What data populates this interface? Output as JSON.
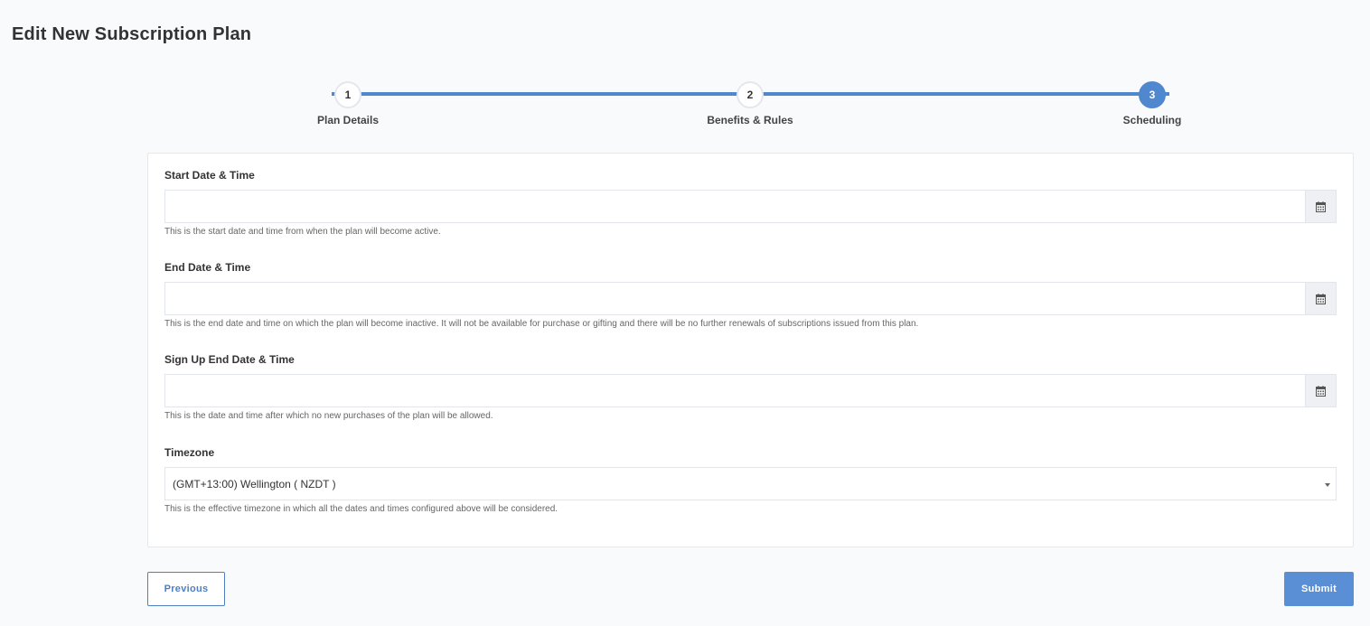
{
  "page": {
    "title": "Edit New Subscription Plan"
  },
  "stepper": {
    "steps": [
      {
        "number": "1",
        "label": "Plan Details"
      },
      {
        "number": "2",
        "label": "Benefits & Rules"
      },
      {
        "number": "3",
        "label": "Scheduling"
      }
    ],
    "active_step": 3
  },
  "form": {
    "start": {
      "label": "Start Date & Time",
      "value": "",
      "help": "This is the start date and time from when the plan will become active."
    },
    "end": {
      "label": "End Date & Time",
      "value": "",
      "help": "This is the end date and time on which the plan will become inactive. It will not be available for purchase or gifting and there will be no further renewals of subscriptions issued from this plan."
    },
    "signup_end": {
      "label": "Sign Up End Date & Time",
      "value": "",
      "help": "This is the date and time after which no new purchases of the plan will be allowed."
    },
    "timezone": {
      "label": "Timezone",
      "selected": "(GMT+13:00) Wellington ( NZDT )",
      "help": "This is the effective timezone in which all the dates and times configured above will be considered."
    }
  },
  "actions": {
    "previous_label": "Previous",
    "submit_label": "Submit"
  },
  "colors": {
    "accent": "#5088d0",
    "submit_bg": "#5b8fd5",
    "previous_border": "#4f7fc1",
    "page_bg": "#f9fafc"
  },
  "icons": {
    "calendar": "calendar-icon",
    "dropdown": "chevron-down-icon"
  }
}
